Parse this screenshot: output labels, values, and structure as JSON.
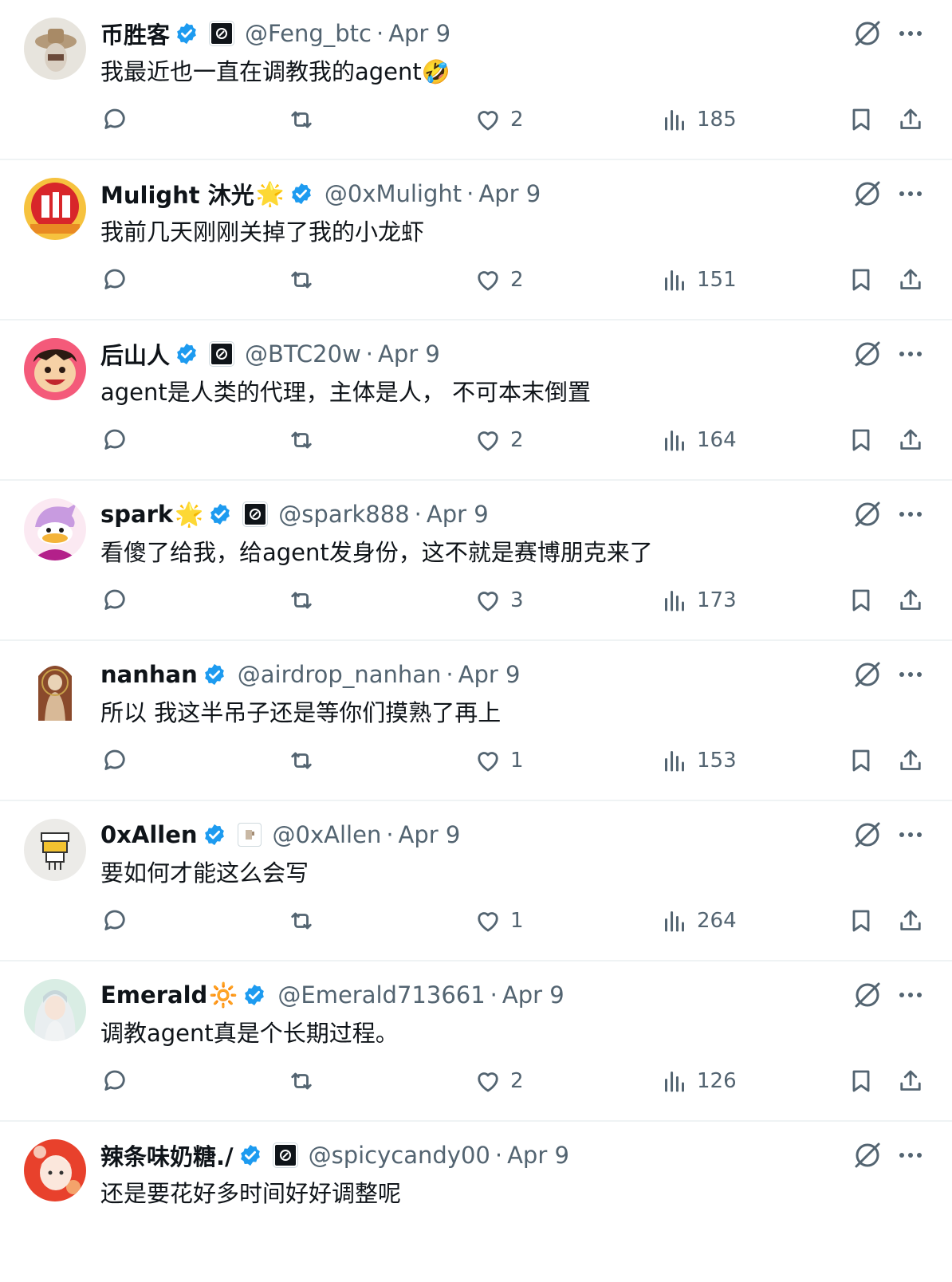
{
  "colors": {
    "verified": "#1d9bf0",
    "meta": "#536471",
    "text": "#0f1419"
  },
  "tweets": [
    {
      "name": "币胜客",
      "emoji": "",
      "handle": "@Feng_btc",
      "time": "Apr 9",
      "text": "我最近也一直在调教我的agent🤣",
      "likes": "2",
      "views": "185",
      "affiliate": "dark"
    },
    {
      "name": "Mulight 沐光",
      "emoji": "🌟",
      "handle": "@0xMulight",
      "time": "Apr 9",
      "text": "我前几天刚刚关掉了我的小龙虾",
      "likes": "2",
      "views": "151",
      "affiliate": "none"
    },
    {
      "name": "后山人",
      "emoji": "",
      "handle": "@BTC20w",
      "time": "Apr 9",
      "text": "agent是人类的代理，主体是人， 不可本末倒置",
      "likes": "2",
      "views": "164",
      "affiliate": "dark"
    },
    {
      "name": "spark",
      "emoji": "🌟",
      "handle": "@spark888",
      "time": "Apr 9",
      "text": "看傻了给我，给agent发身份，这不就是赛博朋克来了",
      "likes": "3",
      "views": "173",
      "affiliate": "dark"
    },
    {
      "name": "nanhan",
      "emoji": "",
      "handle": "@airdrop_nanhan",
      "time": "Apr 9",
      "text": "所以 我这半吊子还是等你们摸熟了再上",
      "likes": "1",
      "views": "153",
      "affiliate": "none"
    },
    {
      "name": "0xAllen",
      "emoji": "",
      "handle": "@0xAllen",
      "time": "Apr 9",
      "text": "要如何才能这么会写",
      "likes": "1",
      "views": "264",
      "affiliate": "light"
    },
    {
      "name": "Emerald",
      "emoji": "🔆",
      "handle": "@Emerald713661",
      "time": "Apr 9",
      "text": "调教agent真是个长期过程。",
      "likes": "2",
      "views": "126",
      "affiliate": "none"
    },
    {
      "name": "辣条味奶糖./",
      "emoji": "",
      "handle": "@spicycandy00",
      "time": "Apr 9",
      "text": "还是要花好多时间好好调整呢",
      "likes": "",
      "views": "",
      "affiliate": "dark"
    }
  ]
}
